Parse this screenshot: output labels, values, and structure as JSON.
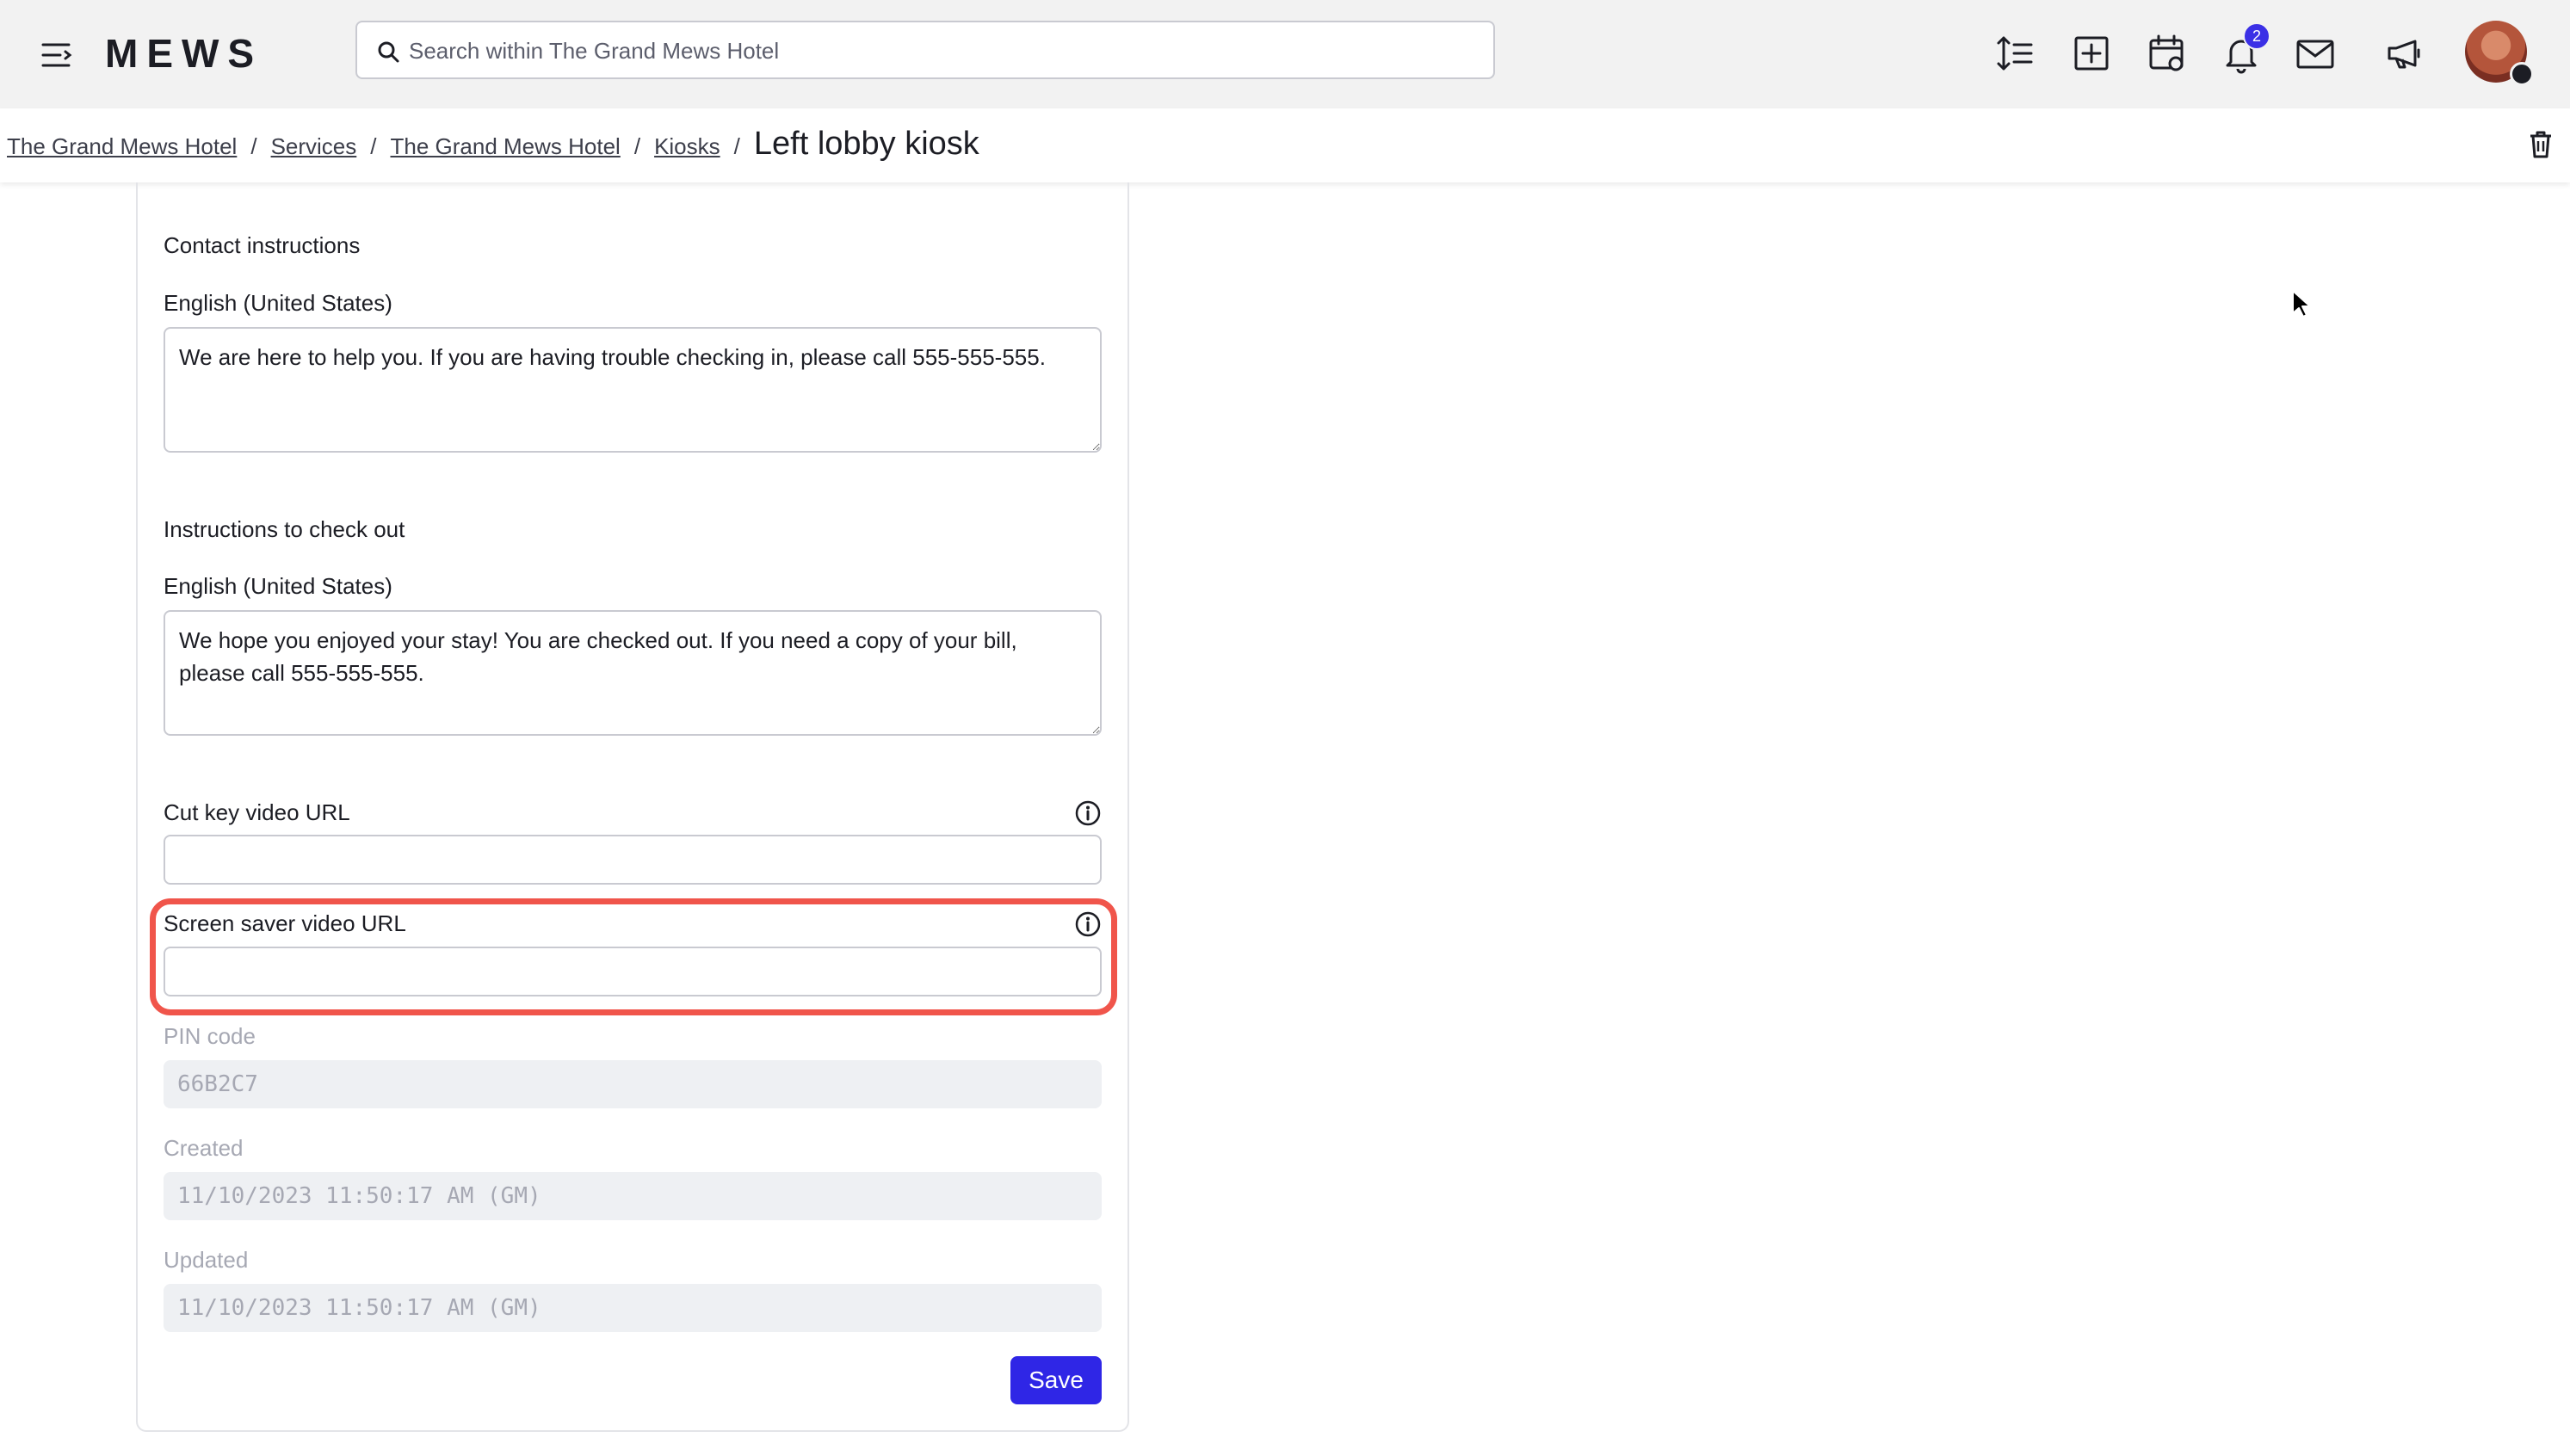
{
  "app": {
    "logo": "MEWS"
  },
  "search": {
    "placeholder": "Search within The Grand Mews Hotel"
  },
  "toolbar": {
    "icons": [
      "line-height-icon",
      "add-icon",
      "calendar-icon",
      "bell-icon",
      "mail-icon",
      "megaphone-icon"
    ],
    "notification_count": "2"
  },
  "breadcrumb": {
    "items": [
      "The Grand Mews Hotel",
      "Services",
      "The Grand Mews Hotel",
      "Kiosks"
    ],
    "separator": "/",
    "current": "Left lobby kiosk"
  },
  "form": {
    "contact": {
      "section_label": "Contact instructions",
      "language_label": "English (United States)",
      "value": "We are here to help you. If you are having trouble checking in, please call 555-555-555."
    },
    "checkout": {
      "section_label": "Instructions to check out",
      "language_label": "English (United States)",
      "value": "We hope you enjoyed your stay! You are checked out. If you need a copy of your bill, please call 555-555-555."
    },
    "cut_key_video": {
      "label": "Cut key video URL",
      "value": ""
    },
    "screen_saver_video": {
      "label": "Screen saver video URL",
      "value": ""
    },
    "pin_code": {
      "label": "PIN code",
      "value": "66B2C7"
    },
    "created": {
      "label": "Created",
      "value": "11/10/2023 11:50:17 AM (GM)"
    },
    "updated": {
      "label": "Updated",
      "value": "11/10/2023 11:50:17 AM (GM)"
    },
    "save_label": "Save"
  },
  "colors": {
    "accent": "#2f26e6",
    "highlight": "#f0554b",
    "topbar": "#f2f2f2"
  }
}
